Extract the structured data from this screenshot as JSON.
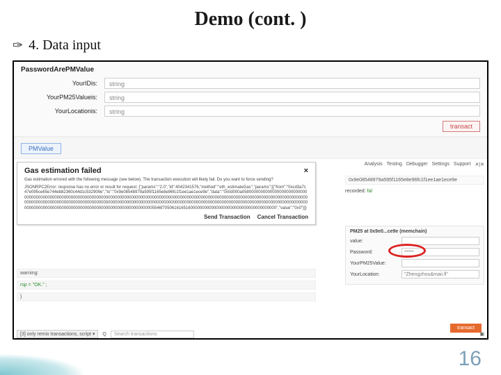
{
  "slide": {
    "title": "Demo (cont. )",
    "bullet": "4. Data input",
    "page_number": "16"
  },
  "form": {
    "panel_name": "PasswordArePMValue",
    "rows": [
      {
        "label": "YourIDis:",
        "placeholder": "string"
      },
      {
        "label": "YourPM25Valueis:",
        "placeholder": "string"
      },
      {
        "label": "YourLocationis:",
        "placeholder": "string"
      }
    ],
    "transact_label": "transact"
  },
  "pmvalue_button": "PMValue",
  "modal": {
    "title": "Gas estimation failed",
    "close": "×",
    "body": [
      "Gas estimation errored with the following message (see below). The transaction execution will likely fail. Do you want to force sending?",
      "JSONRPC2Error: response has no error or result for request: {\"params\":\"2.0\",\"id\":4042341576,\"method\":\"eth_estimateGas\",\"params\":[{\"from\":\"0xcd3a7c47e095ce65e744eb82360c44d1c532909e\",\"to\":\"0x9e08548979a595f1165e8e96fc1f1ee1ae1ece9e\",\"data\":\"0x0d000a0580000000000000000000000000000000000000000000000000000000000000000000000000000000000000000000000000000000000000000000000000000000000000000000000000000000000000000000000000000000000000000000000000000000000000000000000000000000000000000000000000000000000000000000000000000000000000000000000000000000000000000000000000000000000005546f7050616165160000000000000000000000000000000000000\",\"value\":\"0x0\"}]}"
    ],
    "actions": {
      "send": "Send Transaction",
      "cancel": "Cancel Transaction"
    }
  },
  "bg_tabs": [
    "Analysis",
    "Testing",
    "Debugger",
    "Settings",
    "Support"
  ],
  "bg_side": {
    "row1": "0x9e08548979a595f1165e8e96fc1f1ee1ae1ece9e",
    "recorded_label": "recorded:",
    "recorded_value": "fal"
  },
  "pm25": {
    "title": "PM25 at 0x9e0...ce9e (memchain)",
    "rows": [
      {
        "label": "value:",
        "value": ""
      },
      {
        "label": "Password:",
        "value": "*****"
      },
      {
        "label": "YourPM25Value:",
        "value": ""
      },
      {
        "label": "YourLocation:",
        "value": "\"Zhengzhou&maii.fl\""
      }
    ],
    "orange_button": "transact"
  },
  "bg_under": {
    "warning": "warning:",
    "ok_line": "rsp = \"OK.\" ;",
    "brace": "}",
    "select_label": "[3] only remix transactions, script ▾",
    "search_icon": "Q",
    "search_placeholder": "Search transactions"
  }
}
